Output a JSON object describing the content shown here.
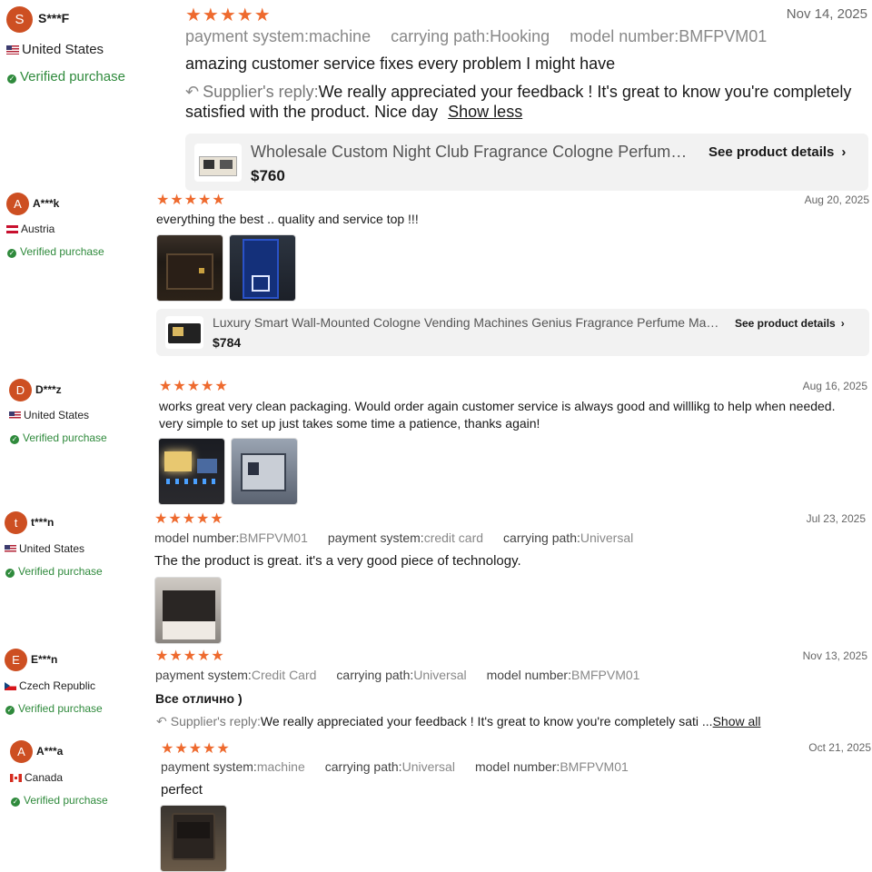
{
  "labels": {
    "verified": "Verified purchase",
    "supplier_reply": "Supplier's reply:",
    "see_details": "See product details",
    "show_less": "Show less",
    "show_all": "Show all"
  },
  "colors": {
    "star": "#ee6a2e",
    "avatar": "#cd4f22",
    "verified": "#2f8a3c"
  },
  "reviews": [
    {
      "initial": "S",
      "name": "S***F",
      "country": "United States",
      "flag": "us-flag",
      "stars": "★★★★★",
      "rating": 5,
      "date": "Nov 14, 2025",
      "attrs": [
        {
          "k": "payment system:",
          "v": "machine"
        },
        {
          "k": "carrying path:",
          "v": "Hooking"
        },
        {
          "k": "model number:",
          "v": "BMFPVM01"
        }
      ],
      "text": "amazing customer service fixes every problem I might have",
      "reply": "We really appreciated your feedback ! It's great to know you're completely satisfied with the product. Nice day",
      "product": {
        "title": "Wholesale Custom Night Club Fragrance Cologne Perfume Vending Machine",
        "price": "$760"
      }
    },
    {
      "initial": "A",
      "name": "A***k",
      "country": "Austria",
      "flag": "austria-flag",
      "stars": "★★★★★",
      "rating": 5,
      "date": "Aug 20, 2025",
      "text": "everything the best .. quality and service top !!!",
      "product": {
        "title": "Luxury Smart Wall-Mounted Cologne Vending Machines Genius Fragrance Perfume Machine",
        "price": "$784"
      }
    },
    {
      "initial": "D",
      "name": "D***z",
      "country": "United States",
      "flag": "us-flag",
      "stars": "★★★★★",
      "rating": 5,
      "date": "Aug 16, 2025",
      "text": "works great very clean packaging. Would order again customer service is always good and willlikg to help when needed. very simple to set up just takes some time a patience, thanks again!"
    },
    {
      "initial": "t",
      "name": "t***n",
      "country": "United States",
      "flag": "us-flag",
      "stars": "★★★★★",
      "rating": 5,
      "date": "Jul 23, 2025",
      "attrs": [
        {
          "k": "model number:",
          "v": "BMFPVM01"
        },
        {
          "k": "payment system:",
          "v": "credit card"
        },
        {
          "k": "carrying path:",
          "v": "Universal"
        }
      ],
      "text": "The the product is great. it's a very good piece of technology."
    },
    {
      "initial": "E",
      "name": "E***n",
      "country": "Czech Republic",
      "flag": "czech-flag",
      "stars": "★★★★★",
      "rating": 5,
      "date": "Nov 13, 2025",
      "attrs": [
        {
          "k": "payment system:",
          "v": "Credit Card"
        },
        {
          "k": "carrying path:",
          "v": "Universal"
        },
        {
          "k": "model number:",
          "v": "BMFPVM01"
        }
      ],
      "text": "Все отлично )",
      "reply": "We really appreciated your feedback ! It's great to know you're completely sati ..."
    },
    {
      "initial": "A",
      "name": "A***a",
      "country": "Canada",
      "flag": "canada-flag",
      "stars": "★★★★★",
      "rating": 5,
      "date": "Oct 21, 2025",
      "attrs": [
        {
          "k": "payment system:",
          "v": "machine"
        },
        {
          "k": "carrying path:",
          "v": "Universal"
        },
        {
          "k": "model number:",
          "v": "BMFPVM01"
        }
      ],
      "text": "perfect"
    }
  ]
}
